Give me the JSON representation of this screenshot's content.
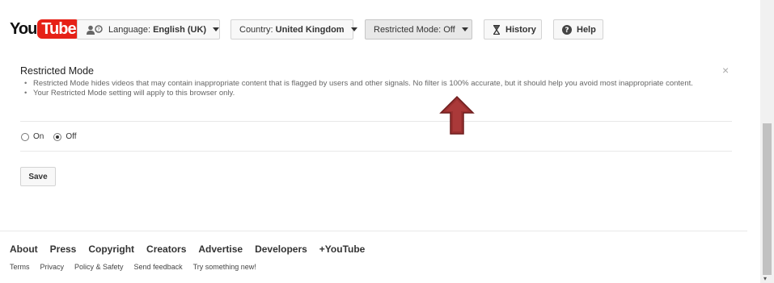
{
  "brand": {
    "you": "You",
    "tube": "Tube"
  },
  "toolbar": {
    "language_prefix": "Language: ",
    "language_value": "English (UK)",
    "country_prefix": "Country: ",
    "country_value": "United Kingdom",
    "restricted_label": "Restricted Mode: Off",
    "history_label": "History",
    "help_label": "Help"
  },
  "restricted": {
    "title": "Restricted Mode",
    "close_symbol": "×",
    "bullets": [
      "Restricted Mode hides videos that may contain inappropriate content that is flagged by users and other signals. No filter is 100% accurate, but it should help you avoid most inappropriate content.",
      "Your Restricted Mode setting will apply to this browser only."
    ],
    "options": [
      {
        "label": "On",
        "checked": false
      },
      {
        "label": "Off",
        "checked": true
      }
    ],
    "save_label": "Save"
  },
  "footer": {
    "primary": [
      "About",
      "Press",
      "Copyright",
      "Creators",
      "Advertise",
      "Developers",
      "+YouTube"
    ],
    "secondary": [
      "Terms",
      "Privacy",
      "Policy & Safety",
      "Send feedback",
      "Try something new!"
    ]
  },
  "colors": {
    "brand_red": "#e62117",
    "annotation_arrow": "#8b2c2c"
  },
  "icons": {
    "language": "people-icon",
    "history": "hourglass-icon",
    "help": "help-circle-icon",
    "close": "close-icon",
    "annotation": "up-arrow-annotation"
  }
}
